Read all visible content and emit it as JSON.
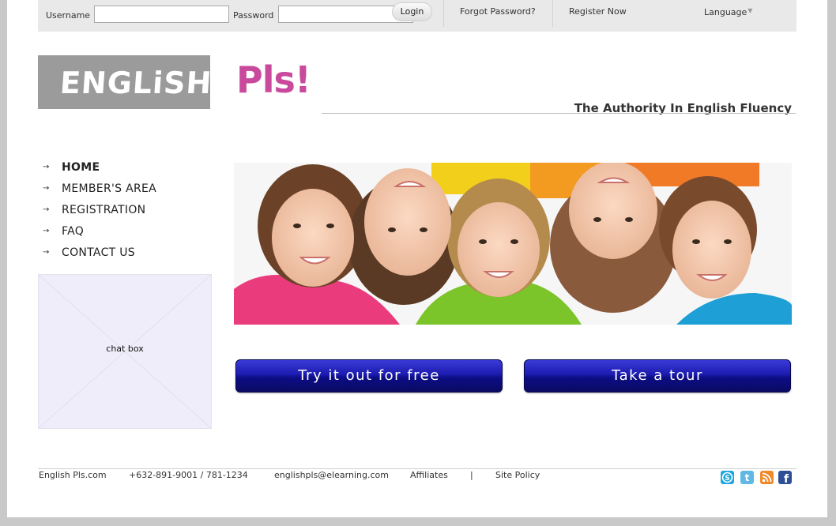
{
  "topbar": {
    "username_label": "Username",
    "username_value": "",
    "password_label": "Password",
    "password_value": "",
    "login_label": "Login",
    "forgot_label": "Forgot Password?",
    "register_label": "Register Now",
    "language_label": "Language"
  },
  "logo": {
    "english_text": "ENGLiSH",
    "pls_text": "Pls!"
  },
  "tagline": "The Authority In English Fluency",
  "nav": {
    "items": [
      {
        "label": "HOME"
      },
      {
        "label": "MEMBER'S AREA"
      },
      {
        "label": "REGISTRATION"
      },
      {
        "label": "FAQ"
      },
      {
        "label": "CONTACT US"
      }
    ]
  },
  "chatbox": {
    "label": "chat box"
  },
  "cta": {
    "free_label": "Try it out for free",
    "tour_label": "Take a tour"
  },
  "footer": {
    "site": "English Pls.com",
    "phone": "+632-891-9001 / 781-1234",
    "email": "englishpls@elearning.com",
    "affiliates": "Affiliates",
    "divider": "|",
    "site_policy": "Site Policy"
  },
  "colors": {
    "brand_pink": "#c94a9c",
    "button_blue": "#1c1cb0",
    "logo_gray": "#9b9b9b"
  },
  "icons": [
    "skype-icon",
    "twitter-icon",
    "rss-icon",
    "facebook-icon"
  ]
}
